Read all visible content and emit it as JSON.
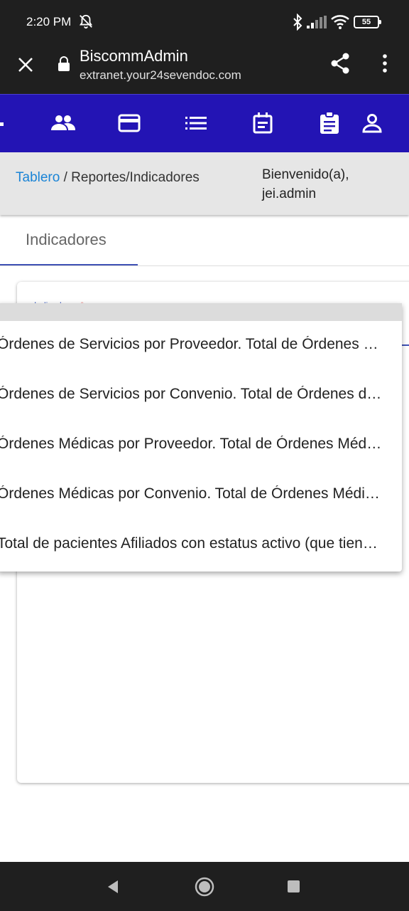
{
  "status_bar": {
    "time": "2:20 PM",
    "battery": "55",
    "icons": [
      "muted-bell-icon",
      "bluetooth-icon",
      "signal-icon",
      "wifi-icon",
      "battery-icon"
    ]
  },
  "browser": {
    "title": "BiscommAdmin",
    "url": "extranet.your24sevendoc.com",
    "icons": [
      "close-icon",
      "lock-icon",
      "share-icon",
      "more-vert-icon"
    ]
  },
  "app_nav": {
    "background": "#2314b4",
    "icons": [
      "people-icon",
      "credit-card-icon",
      "list-icon",
      "event-note-icon",
      "assignment-icon",
      "person-icon"
    ]
  },
  "breadcrumb": {
    "link": "Tablero",
    "rest": " / Reportes/Indicadores"
  },
  "welcome": {
    "line1": "Bienvenido(a),",
    "line2": "jei.admin"
  },
  "tabs": [
    {
      "label": "Indicadores",
      "active": true
    }
  ],
  "form": {
    "field_label": "Indicadores",
    "required_mark": "*"
  },
  "dropdown": {
    "options": [
      "Órdenes de Servicios por Proveedor. Total de Órdenes de Servicios",
      "Órdenes de Servicios por Convenio. Total de Órdenes de Servicios",
      "Órdenes Médicas por Proveedor. Total de Órdenes Médicas",
      "Órdenes Médicas por Convenio. Total de Órdenes Médicas",
      "Total de pacientes Afiliados con estatus activo (que tienen convenio)"
    ]
  },
  "system_nav": {
    "icons": [
      "back-icon",
      "home-icon",
      "recents-icon"
    ]
  }
}
